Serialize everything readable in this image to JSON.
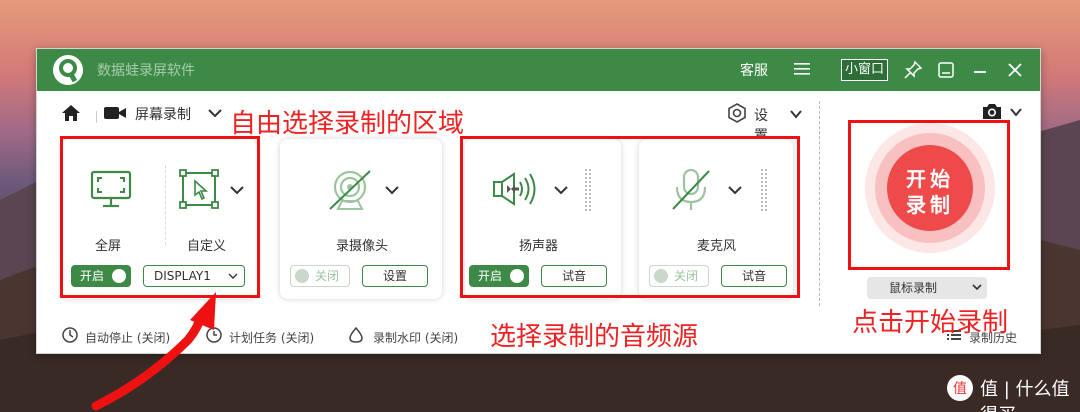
{
  "window": {
    "title": "数据蛙录屏软件",
    "titlebar": {
      "service_label": "客服",
      "mini_window_label": "小窗口"
    }
  },
  "toolbar": {
    "mode_label": "屏幕录制",
    "settings_label": "设置"
  },
  "cards": {
    "screen": {
      "fullscreen_label": "全屏",
      "custom_label": "自定义",
      "toggle_label": "开启",
      "toggle_on": true,
      "display_select_value": "DISPLAY1"
    },
    "camera": {
      "label": "录摄像头",
      "toggle_label": "关闭",
      "toggle_on": false,
      "settings_button": "设置"
    },
    "speaker": {
      "label": "扬声器",
      "toggle_label": "开启",
      "toggle_on": true,
      "test_button": "试音"
    },
    "microphone": {
      "label": "麦克风",
      "toggle_label": "关闭",
      "toggle_on": false,
      "test_button": "试音"
    }
  },
  "record": {
    "button_line1": "开始",
    "button_line2": "录制",
    "mouse_record_label": "鼠标录制"
  },
  "bottom_bar": {
    "auto_stop": "自动停止 (关闭)",
    "scheduled_task": "计划任务 (关闭)",
    "watermark": "录制水印 (关闭)",
    "history": "录制历史"
  },
  "annotations": {
    "select_region": "自由选择录制的区域",
    "select_audio": "选择录制的音频源",
    "click_start": "点击开始录制"
  },
  "site_watermark": "值 | 什么值得买",
  "colors": {
    "brand_green": "#3d8a47",
    "record_red": "#ee4a4a",
    "annotation_red": "#ee2222"
  }
}
